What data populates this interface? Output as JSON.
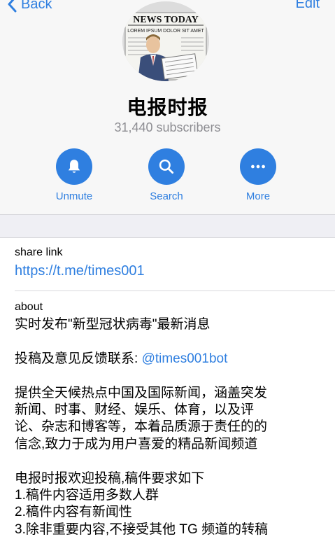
{
  "nav": {
    "back_label": "Back",
    "edit_label": "Edit"
  },
  "channel": {
    "name": "电报时报",
    "subscribers": "31,440 subscribers",
    "avatar_headline": "NEWS TODAY",
    "avatar_subline": "LOREM IPSUM DOLOR SIT AMET"
  },
  "actions": [
    {
      "label": "Unmute",
      "icon": "bell-icon"
    },
    {
      "label": "Search",
      "icon": "search-icon"
    },
    {
      "label": "More",
      "icon": "more-icon"
    }
  ],
  "share": {
    "label": "share link",
    "value": "https://t.me/times001"
  },
  "about": {
    "label": "about",
    "line1": "实时发布\"新型冠状病毒\"最新消息",
    "line2_prefix": "投稿及意见反馈联系: ",
    "line2_mention": "@times001bot",
    "para3": [
      "提供全天候热点中国及国际新闻，涵盖突发",
      "新闻、时事、财经、娱乐、体育，以及评",
      "论、杂志和博客等，本着品质源于责任的的",
      "信念,致力于成为用户喜爱的精品新闻频道"
    ],
    "para4": [
      "电报时报欢迎投稿,稿件要求如下",
      "1.稿件内容适用多数人群",
      "2.稿件内容有新闻性",
      "3.除非重要内容,不接受其他 TG 频道的转稿"
    ]
  },
  "colors": {
    "accent": "#2f7fe0",
    "secondary_text": "#8e8e93",
    "header_bg": "#f7f7f7",
    "band_bg": "#efeff4"
  }
}
